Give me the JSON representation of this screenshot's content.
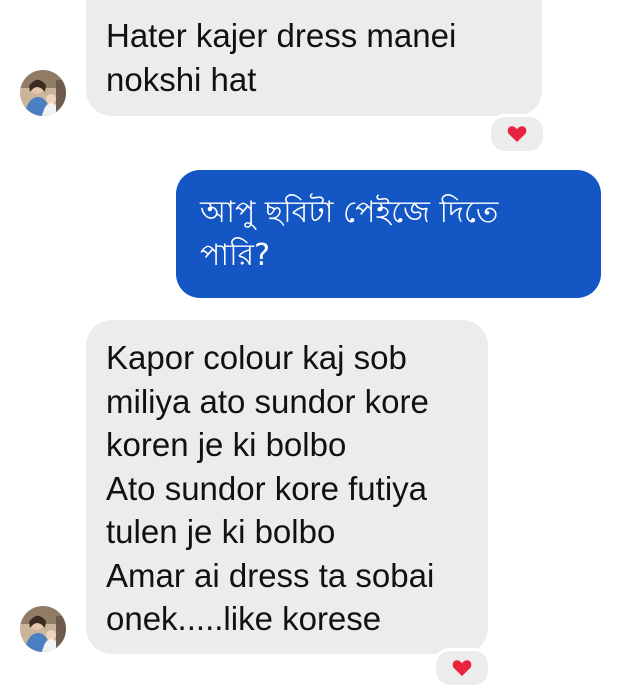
{
  "colors": {
    "incoming_bubble": "#ececec",
    "outgoing_bubble": "#1356c4",
    "heart": "#e8233f",
    "background": "#ffffff"
  },
  "messages": [
    {
      "direction": "incoming",
      "text": "Hater kajer dress manei\nnokshi hat",
      "reaction": "heart-icon"
    },
    {
      "direction": "outgoing",
      "text": "আপু ছবিটা পেইজে দিতে\nপারি?"
    },
    {
      "direction": "incoming",
      "text": "Kapor colour kaj sob\nmiliya ato sundor kore\nkoren je ki bolbo\nAto sundor kore futiya\ntulen je ki bolbo\nAmar ai dress ta sobai\nonek.....like korese",
      "reaction": "heart-icon"
    }
  ]
}
